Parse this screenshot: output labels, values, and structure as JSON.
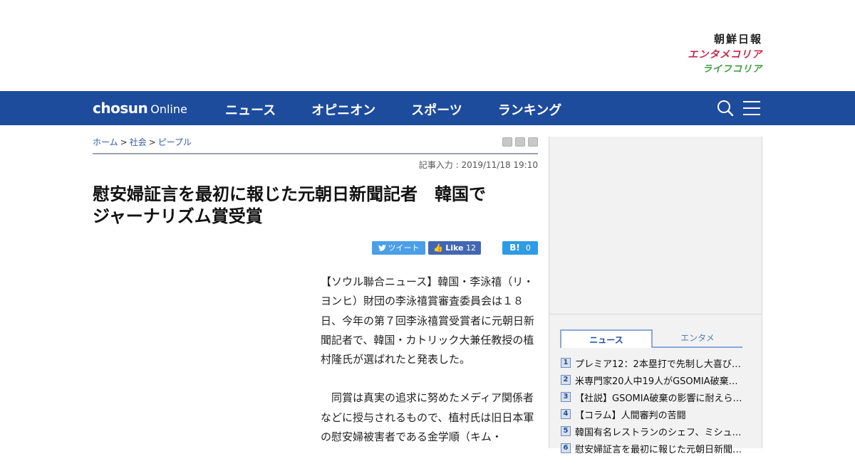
{
  "brand": {
    "chosun": "朝鮮日報",
    "entame": "エンタメコリア",
    "life": "ライフコリア"
  },
  "nav": {
    "logo_bold": "chosun",
    "logo_light": "Online",
    "items": [
      "ニュース",
      "オピニオン",
      "スポーツ",
      "ランキング"
    ],
    "bg_color": "#1e4c9c"
  },
  "breadcrumb": [
    "ホーム",
    "社会",
    "ピープル"
  ],
  "article": {
    "date": "記事入力 : 2019/11/18 19:10",
    "headline_line1": "慰安婦証言を最初に報じた元朝日新聞記者　韓国で",
    "headline_line2": "ジャーナリズム賞受賞",
    "paragraphs": [
      "【ソウル聯合ニュース】韓国・李泳禧（リ・ヨンヒ）財団の李泳禧賞審査委員会は１８日、今年の第７回李泳禧賞受賞者に元朝日新聞記者で、韓国・カトリック大兼任教授の植村隆氏が選ばれたと発表した。",
      "　同賞は真実の追求に努めたメディア関係者などに授与されるもので、植村氏は旧日本軍の慰安婦被害者である金学順（キム・"
    ]
  },
  "share": {
    "tweet": "ツイート",
    "fb_label": "Like",
    "fb_count": "12",
    "hatena_label": "B!",
    "hatena_count": "0"
  },
  "sidebar": {
    "tabs": [
      "ニュース",
      "エンタメ"
    ],
    "ranking": [
      {
        "num": "1",
        "title": "プレミア12：2本塁打で先制し大喜び…"
      },
      {
        "num": "2",
        "title": "米専門家20人中19人がGSOMIA破棄反…"
      },
      {
        "num": "3",
        "title": "【社説】GSOMIA破棄の影響に耐えら…"
      },
      {
        "num": "4",
        "title": "【コラム】人間審判の苦闘"
      },
      {
        "num": "5",
        "title": "韓国有名レストランのシェフ、ミシュ…"
      },
      {
        "num": "6",
        "title": "慰安婦証言を最初に報じた元朝日新聞…"
      }
    ]
  }
}
